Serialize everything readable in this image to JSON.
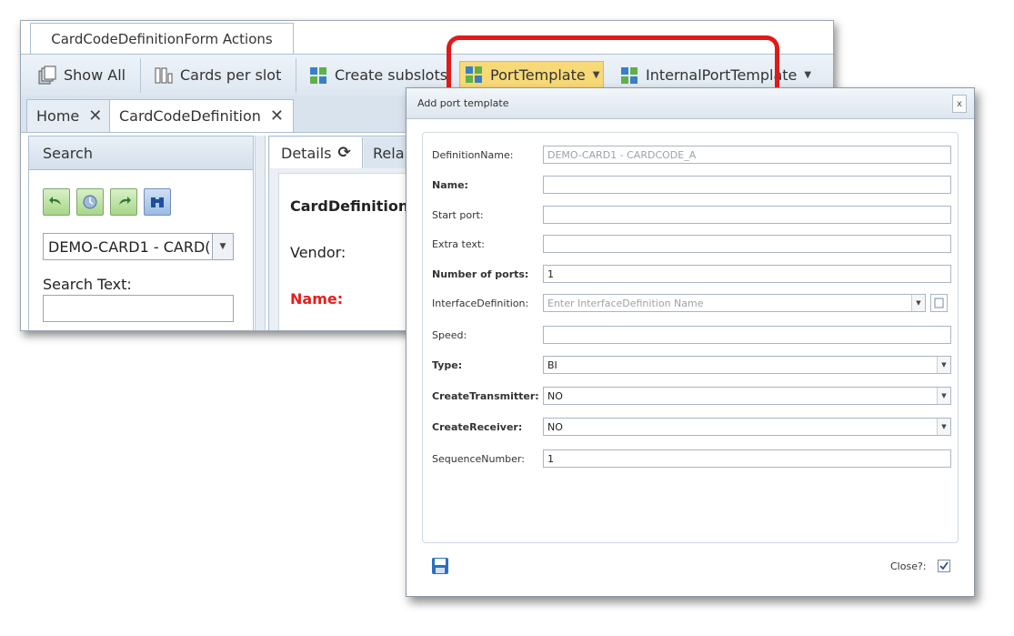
{
  "ribbon": {
    "tab_title": "CardCodeDefinitionForm Actions",
    "buttons": {
      "show_all": "Show All",
      "cards_per_slot": "Cards per slot",
      "create_subslots": "Create subslots",
      "port_template": "PortTemplate",
      "internal_port_template": "InternalPortTemplate"
    }
  },
  "tabs": [
    {
      "label": "Home"
    },
    {
      "label": "CardCodeDefinition"
    }
  ],
  "search_panel": {
    "title": "Search",
    "selected": "DEMO-CARD1 - CARD(",
    "search_text_label": "Search Text:",
    "search_text_value": ""
  },
  "details": {
    "tabs": [
      "Details",
      "Rela"
    ],
    "card_definition_label": "CardDefinition:",
    "vendor_label": "Vendor:",
    "name_label": "Name:"
  },
  "dialog": {
    "title": "Add port template",
    "close_glyph": "x",
    "fields": {
      "definition_name": {
        "label": "DefinitionName:",
        "value": "DEMO-CARD1 - CARDCODE_A"
      },
      "name": {
        "label": "Name:",
        "value": ""
      },
      "start_port": {
        "label": "Start port:",
        "value": ""
      },
      "extra_text": {
        "label": "Extra text:",
        "value": ""
      },
      "number_of_ports": {
        "label": "Number of ports:",
        "value": "1"
      },
      "interface_definition": {
        "label": "InterfaceDefinition:",
        "placeholder": "Enter InterfaceDefinition Name"
      },
      "speed": {
        "label": "Speed:",
        "value": ""
      },
      "type": {
        "label": "Type:",
        "value": "BI"
      },
      "create_transmitter": {
        "label": "CreateTransmitter:",
        "value": "NO"
      },
      "create_receiver": {
        "label": "CreateReceiver:",
        "value": "NO"
      },
      "sequence_number": {
        "label": "SequenceNumber:",
        "value": "1"
      }
    },
    "close_checkbox_label": "Close?:",
    "close_checked": true
  },
  "colors": {
    "highlight": "#e01a1a",
    "active_button": "#f7d978",
    "required_label": "#e41f1f"
  },
  "icons": [
    "cards-icon",
    "slots-icon",
    "subslot-icon",
    "port-template-icon",
    "back-icon",
    "history-icon",
    "forward-icon",
    "binoculars-icon",
    "save-icon",
    "checkbox-check-icon"
  ]
}
